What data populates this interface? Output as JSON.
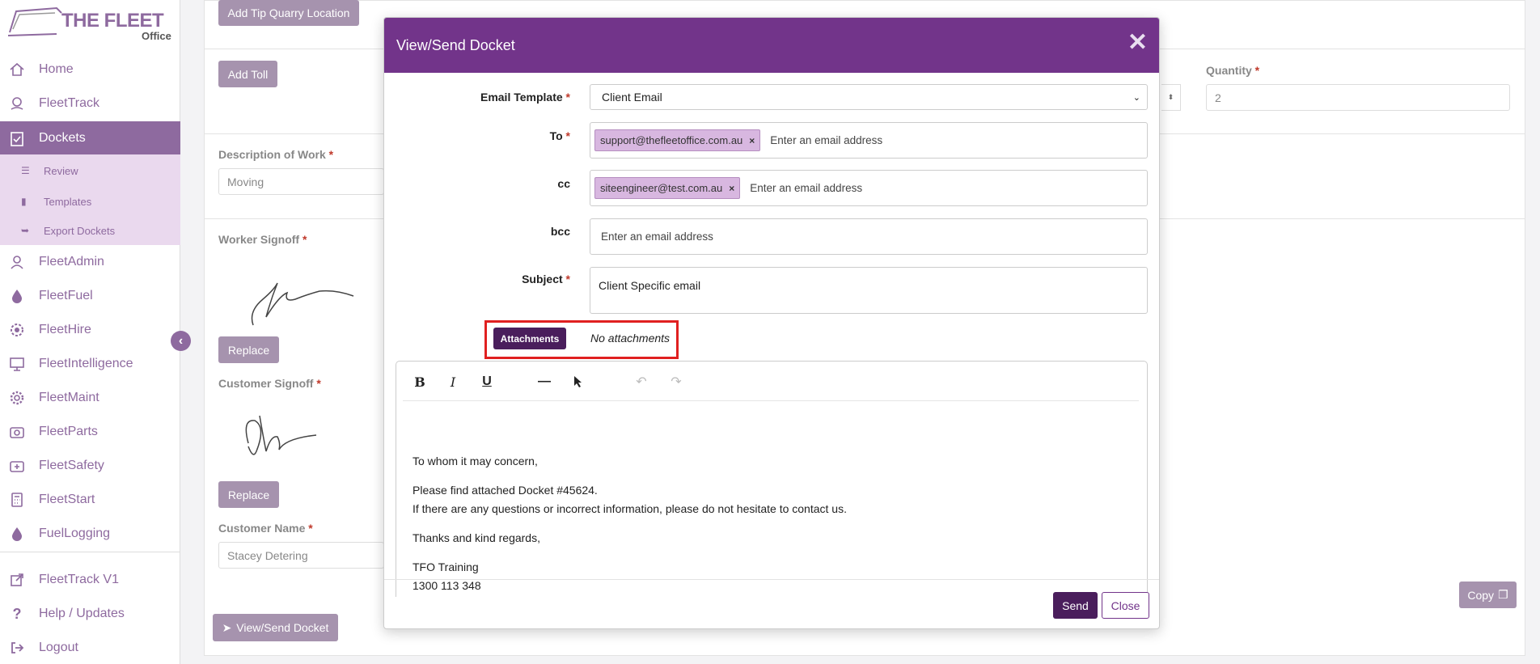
{
  "brand": {
    "name": "THE FLEET",
    "sub": "Office"
  },
  "nav": {
    "items": [
      {
        "label": "Home",
        "icon": "home-icon"
      },
      {
        "label": "FleetTrack",
        "icon": "location-pin-icon"
      },
      {
        "label": "Dockets",
        "icon": "clipboard-check-icon"
      },
      {
        "label": "FleetAdmin",
        "icon": "user-icon"
      },
      {
        "label": "FleetFuel",
        "icon": "droplet-icon"
      },
      {
        "label": "FleetHire",
        "icon": "gear-drop-icon"
      },
      {
        "label": "FleetIntelligence",
        "icon": "presentation-chart-icon"
      },
      {
        "label": "FleetMaint",
        "icon": "cog-icon"
      },
      {
        "label": "FleetParts",
        "icon": "camera-icon"
      },
      {
        "label": "FleetSafety",
        "icon": "first-aid-icon"
      },
      {
        "label": "FleetStart",
        "icon": "calculator-icon"
      },
      {
        "label": "FuelLogging",
        "icon": "droplet-icon"
      },
      {
        "label": "FleetTrack V1",
        "icon": "external-link-icon"
      },
      {
        "label": "Help / Updates",
        "icon": "question-icon"
      },
      {
        "label": "Logout",
        "icon": "logout-icon"
      }
    ],
    "dockets_sub": [
      {
        "label": "Review",
        "icon": "list-icon"
      },
      {
        "label": "Templates",
        "icon": "file-icon"
      },
      {
        "label": "Export Dockets",
        "icon": "file-export-icon"
      }
    ]
  },
  "page": {
    "add_tip_quarry_label": "Add Tip Quarry Location",
    "add_toll_label": "Add Toll",
    "quantity_label": "Quantity",
    "quantity_value": "2",
    "description_label": "Description of Work",
    "description_value": "Moving",
    "worker_signoff_label": "Worker Signoff",
    "customer_signoff_label": "Customer Signoff",
    "replace_label": "Replace",
    "customer_name_label": "Customer Name",
    "customer_name_value": "Stacey Detering",
    "view_send_label": "View/Send Docket",
    "copy_label": "Copy",
    "required_mark": "*"
  },
  "modal": {
    "title": "View/Send Docket",
    "close_glyph": "✕",
    "email_template_label": "Email Template",
    "email_template_value": "Client Email",
    "to_label": "To",
    "to_tags": [
      "support@thefleetoffice.com.au"
    ],
    "cc_label": "cc",
    "cc_tags": [
      "siteengineer@test.com.au"
    ],
    "bcc_label": "bcc",
    "email_placeholder": "Enter an email address",
    "subject_label": "Subject",
    "subject_value": "Client Specific email",
    "attachments_label": "Attachments",
    "no_attachments": "No attachments",
    "toolbar": [
      "bold-icon",
      "italic-icon",
      "underline-icon",
      "horizontal-rule-icon",
      "cursor-icon",
      "undo-icon",
      "redo-icon"
    ],
    "body": {
      "greeting": "To whom it may concern,",
      "line1": "Please find attached Docket #45624.",
      "line2": "If there are any questions or incorrect information, please do not hesitate to contact us.",
      "closing": "Thanks and kind regards,",
      "company": "TFO Training",
      "phone": "1300 113 348"
    },
    "send_label": "Send",
    "close_label": "Close"
  },
  "colors": {
    "brand_purple": "#72348a",
    "dark_purple": "#4a1e5c",
    "muted_purple": "#8e6a9f",
    "highlight_red": "#e02020"
  }
}
